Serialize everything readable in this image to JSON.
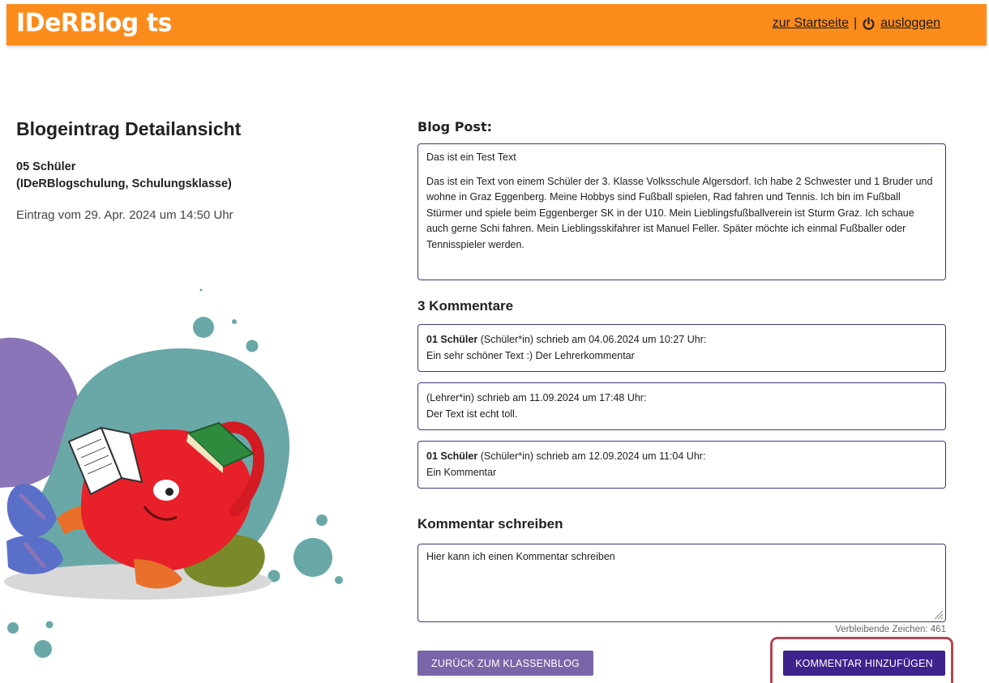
{
  "header": {
    "logo": "IDeRBlog ts",
    "home_link": "zur Startseite",
    "separator": "|",
    "logout_link": "ausloggen",
    "background_color": "#fb8c1c",
    "power_icon": "power-icon"
  },
  "left": {
    "title": "Blogeintrag Detailansicht",
    "author_name": "05 Schüler",
    "author_school": "(IDeRBlogschulung, Schulungsklasse)",
    "date": "Eintrag vom 29. Apr. 2024 um 14:50 Uhr"
  },
  "post": {
    "heading": "Blog Post:",
    "title": "Das ist ein Test Text",
    "body": "Das ist ein Text von einem Schüler der 3. Klasse Volksschule Algersdorf. Ich habe 2 Schwester und 1 Bruder und wohne in Graz Eggenberg. Meine Hobbys sind Fußball spielen, Rad fahren und Tennis. Ich bin im Fußball Stürmer und spiele beim Eggenberger SK in der U10. Mein Lieblingsfußballverein ist Sturm Graz. Ich schaue auch gerne Schi fahren. Mein Lieblingsskifahrer ist Manuel Feller. Später möchte ich einmal Fußballer oder Tennisspieler werden."
  },
  "comments": {
    "heading": "3 Kommentare",
    "items": [
      {
        "author": "01 Schüler",
        "meta": "(Schüler*in) schrieb am 04.06.2024 um 10:27 Uhr:",
        "text": "Ein sehr schöner Text :) Der Lehrerkommentar"
      },
      {
        "author": "",
        "meta": "(Lehrer*in) schrieb am 11.09.2024 um 17:48 Uhr:",
        "text": "Der Text ist echt toll."
      },
      {
        "author": "01 Schüler",
        "meta": "(Schüler*in) schrieb am 12.09.2024 um 11:04 Uhr:",
        "text": "Ein Kommentar"
      }
    ]
  },
  "write": {
    "heading": "Kommentar schreiben",
    "value": "Hier kann ich einen Kommentar schreiben",
    "remaining": "Verbleibende Zeichen: 461"
  },
  "buttons": {
    "back": "ZURÜCK ZUM KLASSENBLOG",
    "add": "KOMMENTAR HINZUFÜGEN"
  },
  "colors": {
    "accent_dark": "#3e238c",
    "accent_light": "#7a65a8",
    "highlight": "#b5474f",
    "border": "#3d3486"
  }
}
